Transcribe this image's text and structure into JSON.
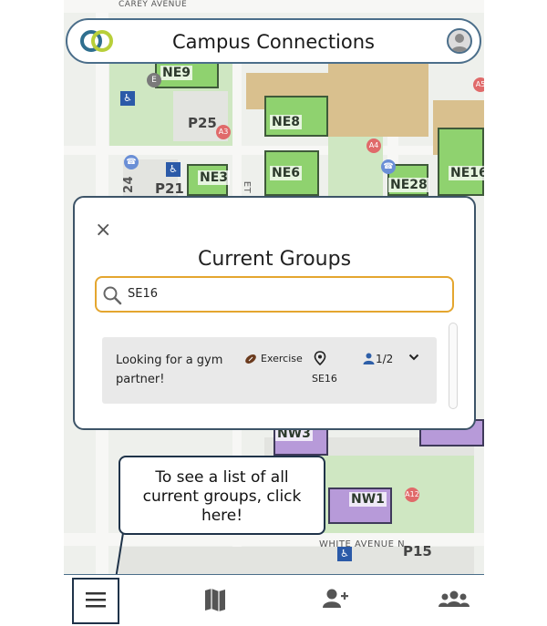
{
  "app": {
    "title": "Campus Connections"
  },
  "map": {
    "street_top": "CAREY AVENUE",
    "street_bottom": "WHITE AVENUE N",
    "buildings": [
      "NE9",
      "NE8",
      "NE6",
      "NE3",
      "NE28",
      "NE16",
      "NW3",
      "NW1"
    ],
    "lots": [
      "P25",
      "P21",
      "P15"
    ],
    "markers": [
      "A3",
      "A4",
      "A5",
      "A12",
      "E"
    ],
    "side_number": "24",
    "side_letters": "ET"
  },
  "modal": {
    "title": "Current Groups",
    "close_symbol": "×",
    "search": {
      "value": "SE16"
    },
    "groups": [
      {
        "name": "Looking for a gym partner!",
        "category": "Exercise",
        "location": "SE16",
        "members": "1/2"
      }
    ]
  },
  "tooltip": {
    "text": "To see a list of all current groups, click here!"
  },
  "nav": {
    "items": [
      "menu",
      "map",
      "add-friend",
      "groups"
    ]
  },
  "colors": {
    "accent": "#4b6e8a",
    "search_border": "#e4a62f",
    "member_icon": "#2e5fa8",
    "nav_icon": "#555555"
  }
}
